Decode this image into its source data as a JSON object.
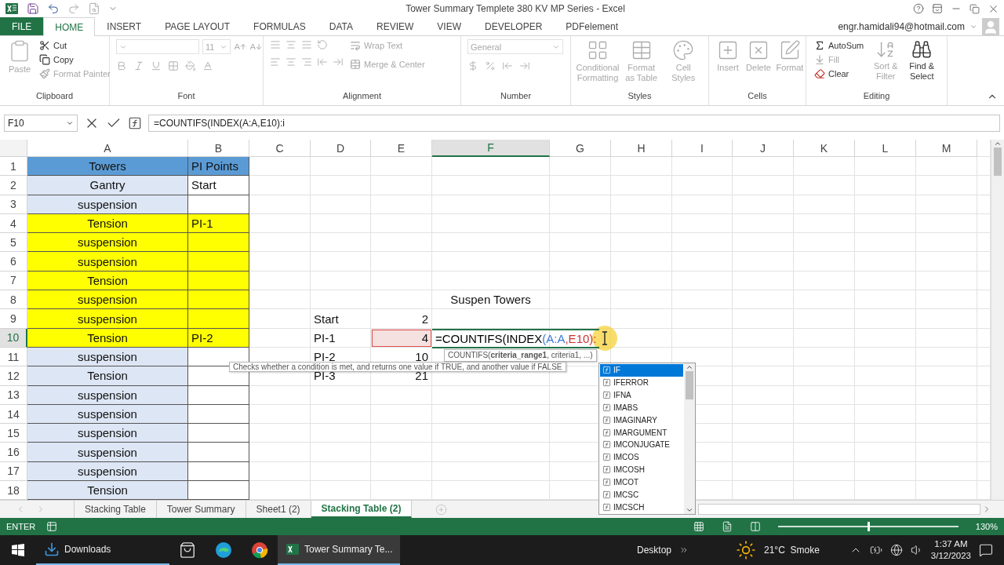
{
  "window": {
    "title": "Tower Summary Templete 380 KV MP Series - Excel",
    "account": "engr.hamidali94@hotmail.com"
  },
  "menu_tabs": [
    {
      "label": "FILE",
      "kind": "file",
      "selected": false
    },
    {
      "label": "HOME",
      "kind": "tab",
      "selected": true
    },
    {
      "label": "INSERT",
      "kind": "tab",
      "selected": false
    },
    {
      "label": "PAGE LAYOUT",
      "kind": "tab",
      "selected": false
    },
    {
      "label": "FORMULAS",
      "kind": "tab",
      "selected": false
    },
    {
      "label": "DATA",
      "kind": "tab",
      "selected": false
    },
    {
      "label": "REVIEW",
      "kind": "tab",
      "selected": false
    },
    {
      "label": "VIEW",
      "kind": "tab",
      "selected": false
    },
    {
      "label": "DEVELOPER",
      "kind": "tab",
      "selected": false
    },
    {
      "label": "PDFelement",
      "kind": "tab",
      "selected": false
    }
  ],
  "ribbon": [
    {
      "kind": "clipboard",
      "label": "Clipboard",
      "paste": {
        "label": "Paste",
        "disabled": true
      },
      "actions": [
        {
          "label": "Cut",
          "disabled": false
        },
        {
          "label": "Copy",
          "disabled": false
        },
        {
          "label": "Format Painter",
          "disabled": true
        }
      ]
    },
    {
      "kind": "font",
      "label": "Font",
      "size": "11"
    },
    {
      "kind": "alignment",
      "label": "Alignment",
      "actions": [
        {
          "label": "Wrap Text",
          "disabled": true
        },
        {
          "label": "Merge & Center",
          "disabled": true
        }
      ]
    },
    {
      "kind": "number",
      "label": "Number",
      "format": "General"
    },
    {
      "kind": "large",
      "label": "Styles",
      "buttons": [
        {
          "label": "Conditional Formatting",
          "disabled": true
        },
        {
          "label": "Format as Table",
          "disabled": true
        },
        {
          "label": "Cell Styles",
          "disabled": true
        }
      ]
    },
    {
      "kind": "large",
      "label": "Cells",
      "buttons": [
        {
          "label": "Insert",
          "disabled": true
        },
        {
          "label": "Delete",
          "disabled": true
        },
        {
          "label": "Format",
          "disabled": true
        }
      ]
    },
    {
      "kind": "editing",
      "label": "Editing",
      "actions": [
        {
          "label": "AutoSum",
          "disabled": false
        },
        {
          "label": "Fill",
          "disabled": true
        },
        {
          "label": "Clear",
          "disabled": false
        }
      ],
      "buttons": [
        {
          "label": "Sort & Filter",
          "disabled": true
        },
        {
          "label": "Find & Select",
          "disabled": false
        }
      ]
    }
  ],
  "formula_bar": {
    "name_box": "F10",
    "formula": "=COUNTIFS(INDEX(A:A,E10):i"
  },
  "columns": [
    {
      "label": "A",
      "selected": false
    },
    {
      "label": "B",
      "selected": false
    },
    {
      "label": "C",
      "selected": false
    },
    {
      "label": "D",
      "selected": false
    },
    {
      "label": "E",
      "selected": false
    },
    {
      "label": "F",
      "selected": true
    },
    {
      "label": "G",
      "selected": false
    },
    {
      "label": "H",
      "selected": false
    },
    {
      "label": "I",
      "selected": false
    },
    {
      "label": "J",
      "selected": false
    },
    {
      "label": "K",
      "selected": false
    },
    {
      "label": "L",
      "selected": false
    },
    {
      "label": "M",
      "selected": false
    }
  ],
  "rows": [
    {
      "number": "1",
      "selected": false,
      "cells": [
        {
          "text": "Towers",
          "color": "#5b9bd5"
        },
        {
          "text": "PI Points",
          "color": "#5b9bd5"
        }
      ]
    },
    {
      "number": "2",
      "selected": false,
      "cells": [
        {
          "text": "Gantry",
          "color": "#dde6f4"
        },
        {
          "text": "Start",
          "color": "#ffffff"
        }
      ]
    },
    {
      "number": "3",
      "selected": false,
      "cells": [
        {
          "text": "suspension",
          "color": "#dde6f4"
        },
        {
          "color": "#ffffff"
        }
      ]
    },
    {
      "number": "4",
      "selected": false,
      "cells": [
        {
          "text": "Tension",
          "color": "#ffff00"
        },
        {
          "text": "PI-1",
          "color": "#ffff00"
        }
      ]
    },
    {
      "number": "5",
      "selected": false,
      "cells": [
        {
          "text": "suspension",
          "color": "#ffff00"
        },
        {
          "color": "#ffff00"
        }
      ]
    },
    {
      "number": "6",
      "selected": false,
      "cells": [
        {
          "text": "suspension",
          "color": "#ffff00"
        },
        {
          "color": "#ffff00"
        }
      ]
    },
    {
      "number": "7",
      "selected": false,
      "cells": [
        {
          "text": "Tension",
          "color": "#ffff00"
        },
        {
          "color": "#ffff00"
        }
      ]
    },
    {
      "number": "8",
      "selected": false,
      "cells": [
        {
          "text": "suspension",
          "color": "#ffff00"
        },
        {
          "color": "#ffff00"
        },
        {},
        {},
        {},
        {
          "text": "Suspen Towers"
        }
      ]
    },
    {
      "number": "9",
      "selected": false,
      "cells": [
        {
          "text": "suspension",
          "color": "#ffff00"
        },
        {
          "color": "#ffff00"
        },
        {},
        {
          "text": "Start"
        },
        {
          "text": "2"
        }
      ]
    },
    {
      "number": "10",
      "selected": true,
      "cells": [
        {
          "text": "Tension",
          "color": "#ffff00"
        },
        {
          "text": "PI-2",
          "color": "#ffff00"
        },
        {},
        {
          "text": "PI-1"
        },
        {
          "text": "4",
          "referenced": true
        }
      ]
    },
    {
      "number": "11",
      "selected": false,
      "cells": [
        {
          "text": "suspension",
          "color": "#dde6f4"
        },
        {
          "color": "#ffffff"
        },
        {},
        {
          "text": "PI-2"
        },
        {
          "text": "10"
        }
      ]
    },
    {
      "number": "12",
      "selected": false,
      "cells": [
        {
          "text": "Tension",
          "color": "#dde6f4"
        },
        {
          "color": "#ffffff"
        },
        {},
        {
          "text": "PI-3"
        },
        {
          "text": "21"
        }
      ]
    },
    {
      "number": "13",
      "selected": false,
      "cells": [
        {
          "text": "suspension",
          "color": "#dde6f4"
        },
        {
          "color": "#ffffff"
        }
      ]
    },
    {
      "number": "14",
      "selected": false,
      "cells": [
        {
          "text": "suspension",
          "color": "#dde6f4"
        },
        {
          "color": "#ffffff"
        }
      ]
    },
    {
      "number": "15",
      "selected": false,
      "cells": [
        {
          "text": "suspension",
          "color": "#dde6f4"
        },
        {
          "color": "#ffffff"
        }
      ]
    },
    {
      "number": "16",
      "selected": false,
      "cells": [
        {
          "text": "suspension",
          "color": "#dde6f4"
        },
        {
          "color": "#ffffff"
        }
      ]
    },
    {
      "number": "17",
      "selected": false,
      "cells": [
        {
          "text": "suspension",
          "color": "#dde6f4"
        },
        {
          "color": "#ffffff"
        }
      ]
    },
    {
      "number": "18",
      "selected": false,
      "cells": [
        {
          "text": "Tension",
          "color": "#dde6f4"
        },
        {
          "color": "#ffffff"
        }
      ]
    }
  ],
  "cell_editor": {
    "parts": [
      {
        "text": "=COUNTIFS(INDEX",
        "color": "#000000"
      },
      {
        "text": "(A:A",
        "color": "#3d78d8"
      },
      {
        "text": ",E10):",
        "color": "#cc3333"
      }
    ]
  },
  "syntax_tip": "COUNTIFS(**criteria_range1**, criteria1, ...)",
  "function_tip": "Checks whether a condition is met, and returns one value if TRUE, and another value if FALSE",
  "autocomplete": [
    {
      "label": "IF",
      "selected": true
    },
    {
      "label": "IFERROR",
      "selected": false
    },
    {
      "label": "IFNA",
      "selected": false
    },
    {
      "label": "IMABS",
      "selected": false
    },
    {
      "label": "IMAGINARY",
      "selected": false
    },
    {
      "label": "IMARGUMENT",
      "selected": false
    },
    {
      "label": "IMCONJUGATE",
      "selected": false
    },
    {
      "label": "IMCOS",
      "selected": false
    },
    {
      "label": "IMCOSH",
      "selected": false
    },
    {
      "label": "IMCOT",
      "selected": false
    },
    {
      "label": "IMCSC",
      "selected": false
    },
    {
      "label": "IMCSCH",
      "selected": false
    }
  ],
  "sheet_tabs": [
    {
      "label": "Stacking Table",
      "selected": false
    },
    {
      "label": "Tower Summary",
      "selected": false
    },
    {
      "label": "Sheet1 (2)",
      "selected": false
    },
    {
      "label": "Stacking Table (2)",
      "selected": true
    }
  ],
  "status_bar": {
    "mode": "ENTER",
    "zoom": {
      "level": 0.5,
      "reading": "130%"
    }
  },
  "taskbar": {
    "downloads": "Downloads",
    "excel_window": "Tower Summary Te...",
    "desktop": "Desktop",
    "weather": "21°C  Smoke",
    "time": "1:37 AM",
    "date": "3/12/2023"
  }
}
